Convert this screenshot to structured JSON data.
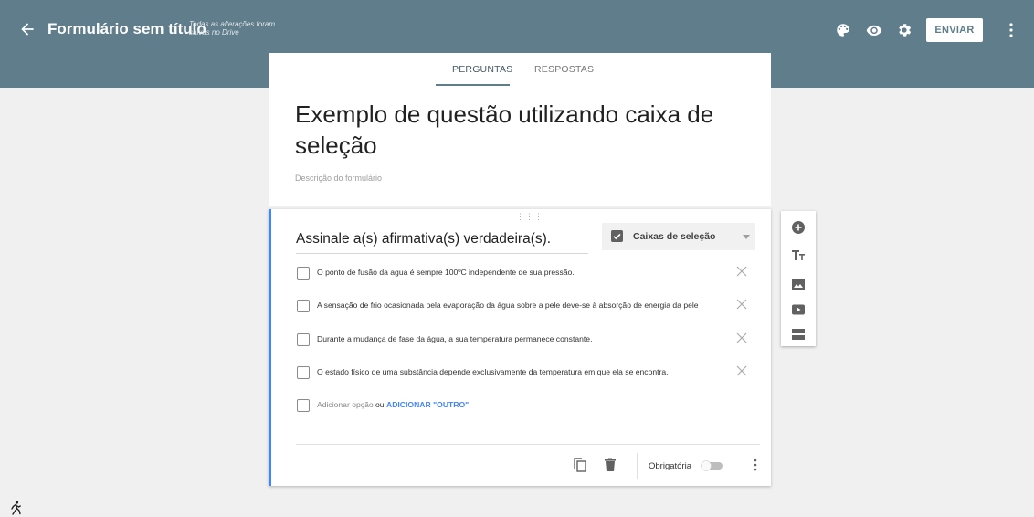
{
  "header": {
    "title": "Formulário sem título",
    "saved_status": "Todas as alterações foram salvas no Drive",
    "send_label": "ENVIAR",
    "icons": [
      "back-arrow-icon",
      "palette-icon",
      "eye-icon",
      "gear-icon",
      "more-vert-icon"
    ],
    "bg_color": "#607d8b"
  },
  "tabs": [
    {
      "label": "PERGUNTAS",
      "active": true
    },
    {
      "label": "RESPOSTAS",
      "active": false
    }
  ],
  "form": {
    "title": "Exemplo de questão utilizando caixa de seleção",
    "description_placeholder": "Descrição do formulário"
  },
  "question": {
    "text": "Assinale a(s) afirmativa(s) verdadeira(s).",
    "type_label": "Caixas de seleção",
    "options": [
      "O ponto de fusão da agua é sempre 100ºC independente de sua pressão.",
      "A sensação de frio ocasionada pela evaporação da água sobre a pele deve-se à absorção de energia da pele",
      "Durante a mudança de fase da água, a sua temperatura permanece constante.",
      "O estado físico de uma substância depende exclusivamente da temperatura em que ela se encontra."
    ],
    "add_option": "Adicionar opção",
    "add_or": "ou",
    "add_other": "ADICIONAR \"OUTRO\"",
    "required_label": "Obrigatória",
    "required": false,
    "accent_color": "#4285f4"
  },
  "side_tools": [
    "add-question-icon",
    "add-title-icon",
    "add-image-icon",
    "add-video-icon",
    "add-section-icon"
  ]
}
